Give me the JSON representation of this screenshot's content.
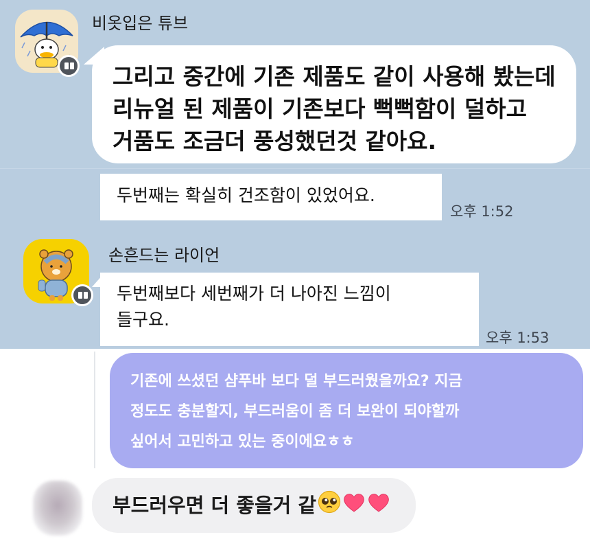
{
  "messages": [
    {
      "sender": "비옷입은 튜브",
      "avatar_icon": "tube-raincoat-avatar-icon",
      "lines": [
        "그리고 중간에 기존 제품도 같이 사용해 봤는데",
        "리뉴얼 된 제품이 기존보다 뻑뻑함이 덜하고",
        "거품도 조금더 풍성했던것 같아요."
      ]
    },
    {
      "lines": [
        "두번째는 확실히 건조함이 있었어요."
      ],
      "time": "오후 1:52"
    },
    {
      "sender": "손흔드는 라이언",
      "avatar_icon": "ryan-avatar-icon",
      "lines": [
        "두번째보다 세번째가 더 나아진 느낌이",
        "들구요."
      ],
      "time": "오후 1:53"
    },
    {
      "mine": true,
      "lines": [
        "기존에 쓰셨던 샴푸바 보다 덜 부드러웠을까요? 지금",
        "정도도 충분할지, 부드러움이 좀 더 보완이 되야할까",
        "싶어서 고민하고 있는 중이에요ㅎㅎ"
      ]
    },
    {
      "lines": [
        "부드러우면 더 좋을거 같"
      ],
      "emojis": [
        "pleading-face-icon",
        "heart-icon",
        "heart-icon"
      ]
    }
  ],
  "colors": {
    "chat_bg": "#bacee0",
    "my_bubble": "#a8abf1",
    "reply_bubble": "#f0f0f2",
    "ryan_yellow": "#f6d100"
  }
}
